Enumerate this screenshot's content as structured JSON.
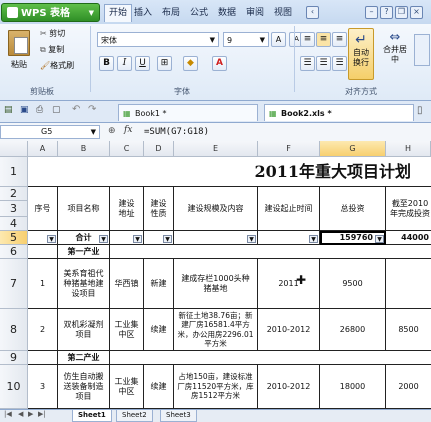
{
  "app": {
    "brand": "WPS 表格"
  },
  "ribbon_tabs": [
    "开始",
    "插入",
    "布局",
    "公式",
    "数据",
    "审阅",
    "视图"
  ],
  "clipboard": {
    "paste": "粘贴",
    "cut": "剪切",
    "copy": "复制",
    "format_painter": "格式刷",
    "group": "剪贴板"
  },
  "font": {
    "name": "宋体",
    "size": "9",
    "bold": "B",
    "italic": "I",
    "underline": "U",
    "group": "字体",
    "grow": "A",
    "shrink": "A"
  },
  "alignment": {
    "wrap": "自动换行",
    "merge": "合并居中",
    "group": "对齐方式"
  },
  "documents": [
    {
      "label": "Book1 *"
    },
    {
      "label": "Book2.xls *"
    }
  ],
  "formula_bar": {
    "cell_ref": "G5",
    "formula": "=SUM(G7:G18)",
    "fx": "fx"
  },
  "columns": [
    "A",
    "B",
    "C",
    "D",
    "E",
    "F",
    "G",
    "H"
  ],
  "selected_column": "G",
  "rows": [
    "1",
    "2",
    "3",
    "4",
    "5",
    "6",
    "7",
    "8",
    "9",
    "10"
  ],
  "selected_row": "5",
  "sheet": {
    "title": "2011年重大项目计划",
    "headers": {
      "a": "序号",
      "b": "项目名称",
      "c": "建设地址",
      "d": "建设性质",
      "e": "建设规模及内容",
      "f": "建设起止时间",
      "g": "总投资",
      "h": "截至2010年完成投资"
    },
    "row5": {
      "b": "合计",
      "g": "159760",
      "h": "44000"
    },
    "section1": "第一产业",
    "r7": {
      "a": "1",
      "b": "美系育祖代种猪基地建设项目",
      "c": "华西镇",
      "d": "新建",
      "e": "建成存栏1000头种猪基地",
      "f": "2011",
      "g": "9500",
      "h": ""
    },
    "r8": {
      "a": "2",
      "b": "双机彩凝剂项目",
      "c": "工业集中区",
      "d": "续建",
      "e": "新征土地38.76亩；新建厂房16581.4平方米，办公用房2296.01平方米",
      "f": "2010-2012",
      "g": "26800",
      "h": "8500"
    },
    "section2": "第二产业",
    "r10": {
      "a": "3",
      "b": "仿生自动搬送装备制造项目",
      "c": "工业集中区",
      "d": "续建",
      "e": "占地150亩，建设标准厂房11520平方米，库房1512平方米",
      "f": "2010-2012",
      "g": "18000",
      "h": "2000"
    }
  },
  "sheet_tabs": [
    "Sheet1",
    "Sheet2",
    "Sheet3"
  ],
  "colors": {
    "brand": "#3a9a2e",
    "header_highlight": "#f7cf6f"
  }
}
